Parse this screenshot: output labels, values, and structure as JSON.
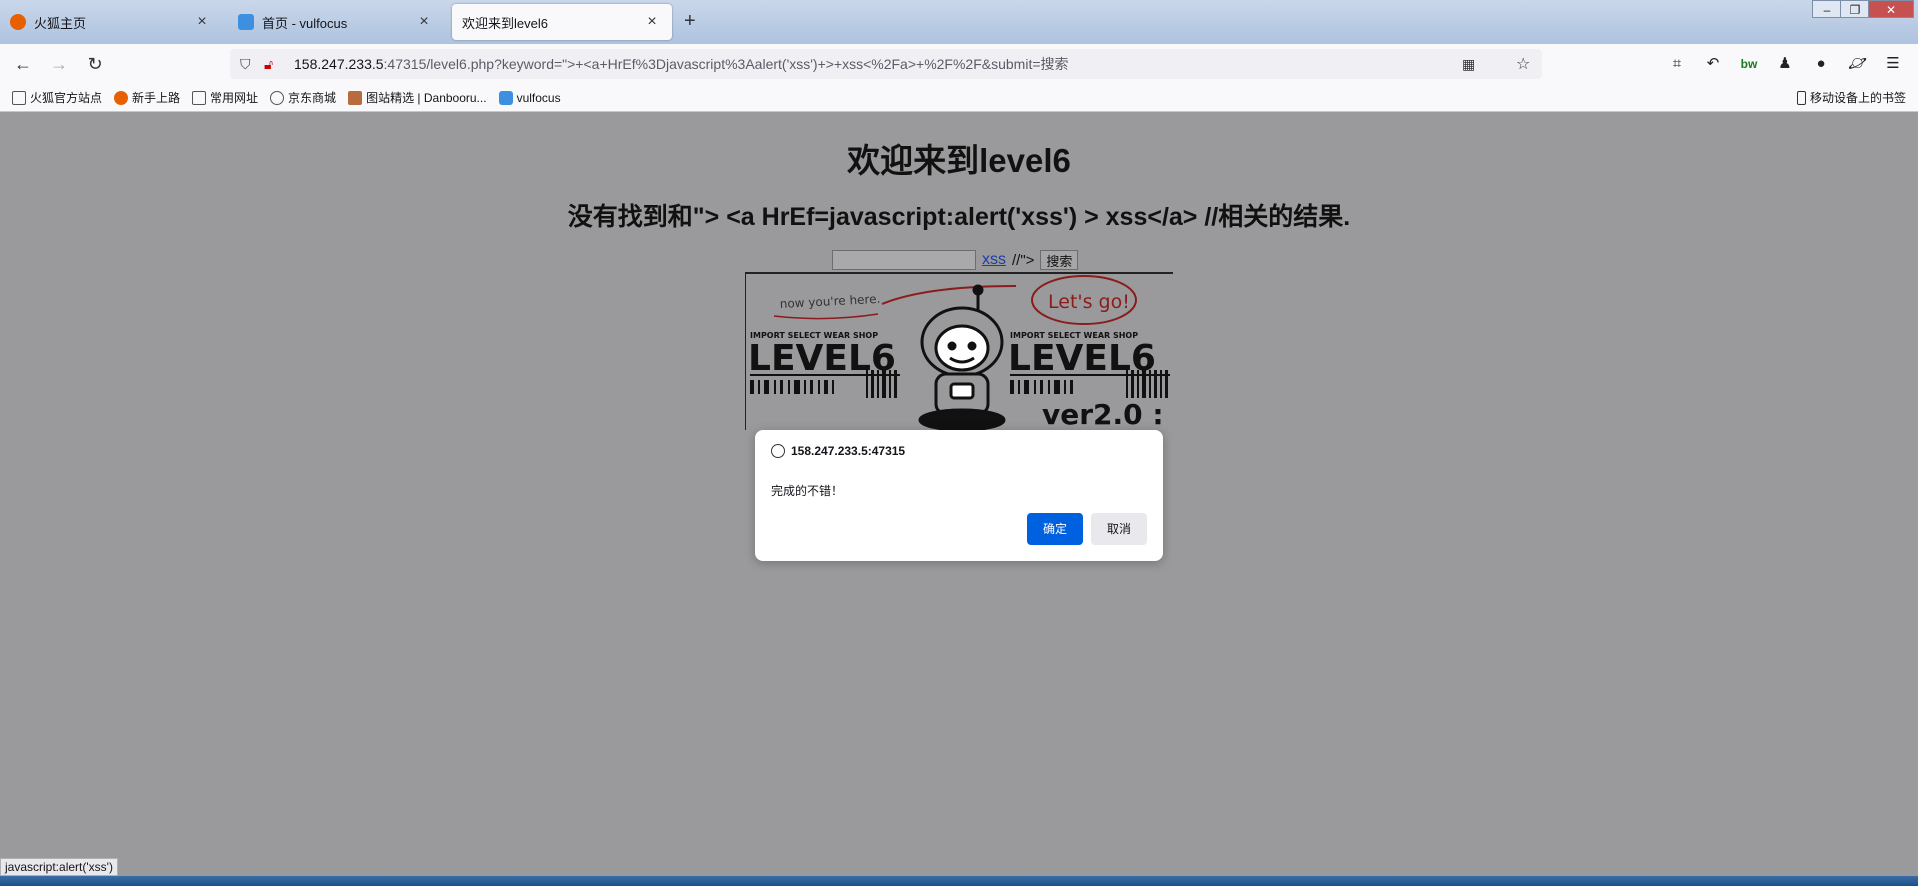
{
  "tabs": [
    {
      "title": "火狐主页",
      "favicon_color": "#e66000"
    },
    {
      "title": "首页 - vulfocus",
      "favicon_color": "#3d8fe0"
    },
    {
      "title": "欢迎来到level6",
      "favicon_color": "#f9f9fb",
      "active": true
    }
  ],
  "window_controls": {
    "minimize": "–",
    "restore": "❐",
    "close": "✕"
  },
  "navbar": {
    "url_host": "158.247.233.5",
    "url_rest": ":47315/level6.php?keyword=\">+<a+HrEf%3Djavascript%3Aalert('xss')+>+xss<%2Fa>+%2F%2F&submit=搜索",
    "icons": [
      "back-icon",
      "forward-icon",
      "reload-icon",
      "shield-icon",
      "insecure-lock-icon",
      "qr-code-icon",
      "bookmark-star-icon",
      "crop-icon",
      "undo-icon",
      "extension-bw-icon",
      "incognito-icon",
      "circle-icon",
      "saturn-icon",
      "menu-icon"
    ]
  },
  "bookmarks": [
    {
      "label": "火狐官方站点",
      "icon": "folder-icon"
    },
    {
      "label": "新手上路",
      "icon": "firefox-icon"
    },
    {
      "label": "常用网址",
      "icon": "folder-icon"
    },
    {
      "label": "京东商城",
      "icon": "globe-icon"
    },
    {
      "label": "图站精选 | Danbooru...",
      "icon": "danbooru-icon"
    },
    {
      "label": "vulfocus",
      "icon": "vulfocus-icon"
    }
  ],
  "mobile_bookmarks": "移动设备上的书签",
  "page": {
    "heading": "欢迎来到level6",
    "result_text": "没有找到和\"> <a HrEf=javascript:alert('xss') > xss</a> //相关的结果.",
    "input_value": "",
    "link_text": "xss",
    "after_link": "//\">",
    "search_button": "搜索",
    "banner": {
      "note_left": "now you're here.",
      "note_right": "Let's go!",
      "shop_left": "IMPORT SELECT WEAR SHOP",
      "shop_right": "IMPORT SELECT WEAR SHOP",
      "level_left": "LEVEL6",
      "level_right": "LEVEL6",
      "version": "ver2.0 :"
    }
  },
  "dialog": {
    "origin": "158.247.233.5:47315",
    "message": "完成的不错！",
    "ok": "确定",
    "cancel": "取消"
  },
  "status_text": "javascript:alert('xss')"
}
